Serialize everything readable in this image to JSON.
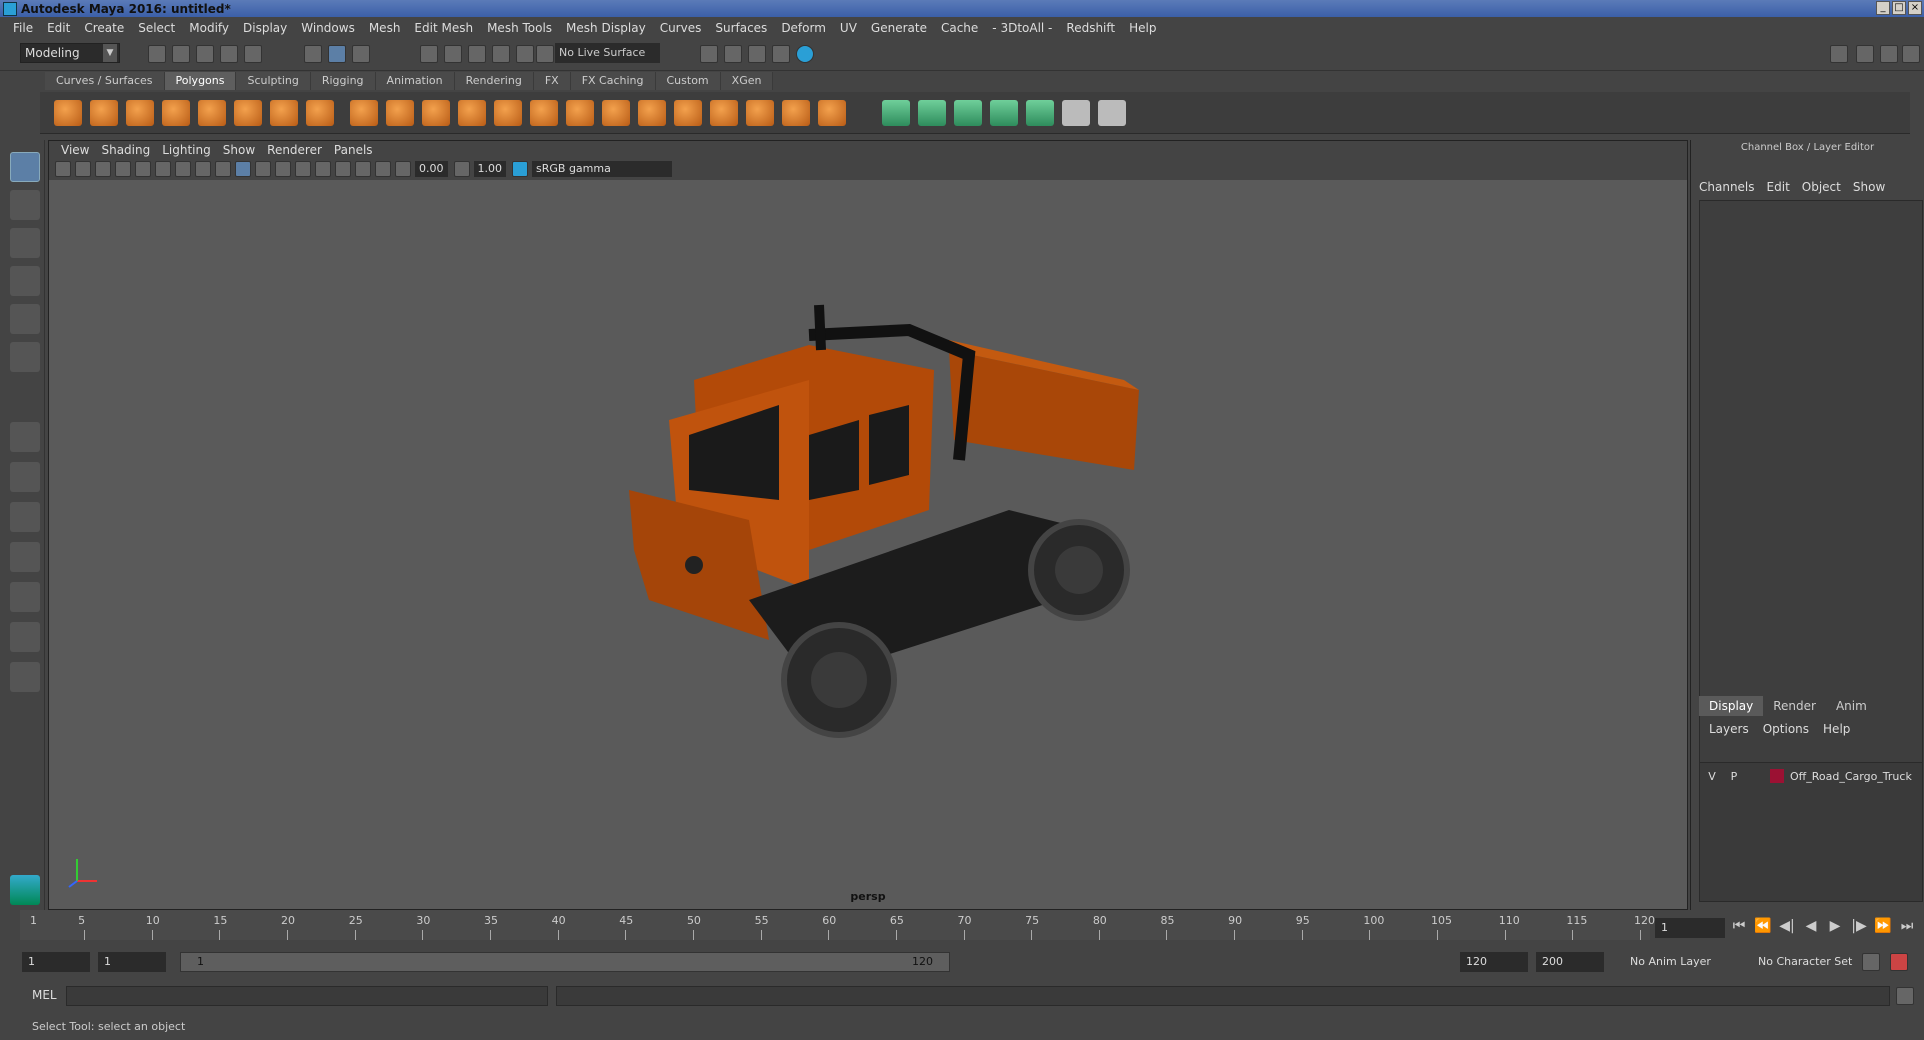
{
  "window": {
    "title": "Autodesk Maya 2016: untitled*"
  },
  "menu": [
    "File",
    "Edit",
    "Create",
    "Select",
    "Modify",
    "Display",
    "Windows",
    "Mesh",
    "Edit Mesh",
    "Mesh Tools",
    "Mesh Display",
    "Curves",
    "Surfaces",
    "Deform",
    "UV",
    "Generate",
    "Cache",
    "- 3DtoAll -",
    "Redshift",
    "Help"
  ],
  "statusline": {
    "mode": "Modeling",
    "live_surface": "No Live Surface"
  },
  "shelf_tabs": [
    "Curves / Surfaces",
    "Polygons",
    "Sculpting",
    "Rigging",
    "Animation",
    "Rendering",
    "FX",
    "FX Caching",
    "Custom",
    "XGen"
  ],
  "shelf_active": "Polygons",
  "viewport": {
    "menu": [
      "View",
      "Shading",
      "Lighting",
      "Show",
      "Renderer",
      "Panels"
    ],
    "exposure": "0.00",
    "gamma": "1.00",
    "colorspace": "sRGB gamma",
    "camera": "persp"
  },
  "channel_box": {
    "title": "Channel Box / Layer Editor",
    "menu": [
      "Channels",
      "Edit",
      "Object",
      "Show"
    ]
  },
  "layer_editor": {
    "tabs": [
      "Display",
      "Render",
      "Anim"
    ],
    "active_tab": "Display",
    "menu": [
      "Layers",
      "Options",
      "Help"
    ],
    "layers": [
      {
        "v": "V",
        "p": "P",
        "name": "Off_Road_Cargo_Truck",
        "color": "#9b1133"
      }
    ]
  },
  "timeline": {
    "ticks": [
      "5",
      "10",
      "15",
      "20",
      "25",
      "30",
      "35",
      "40",
      "45",
      "50",
      "55",
      "60",
      "65",
      "70",
      "75",
      "80",
      "85",
      "90",
      "95",
      "100",
      "105",
      "110",
      "115",
      "120"
    ],
    "start_label": "1",
    "current_frame": "1"
  },
  "range": {
    "start": "1",
    "playback_start": "1",
    "slider_start": "1",
    "slider_end": "120",
    "playback_end": "120",
    "end": "200",
    "anim_layer": "No Anim Layer",
    "character_set": "No Character Set"
  },
  "command_line": {
    "label": "MEL"
  },
  "help_line": {
    "text": "Select Tool: select an object"
  }
}
